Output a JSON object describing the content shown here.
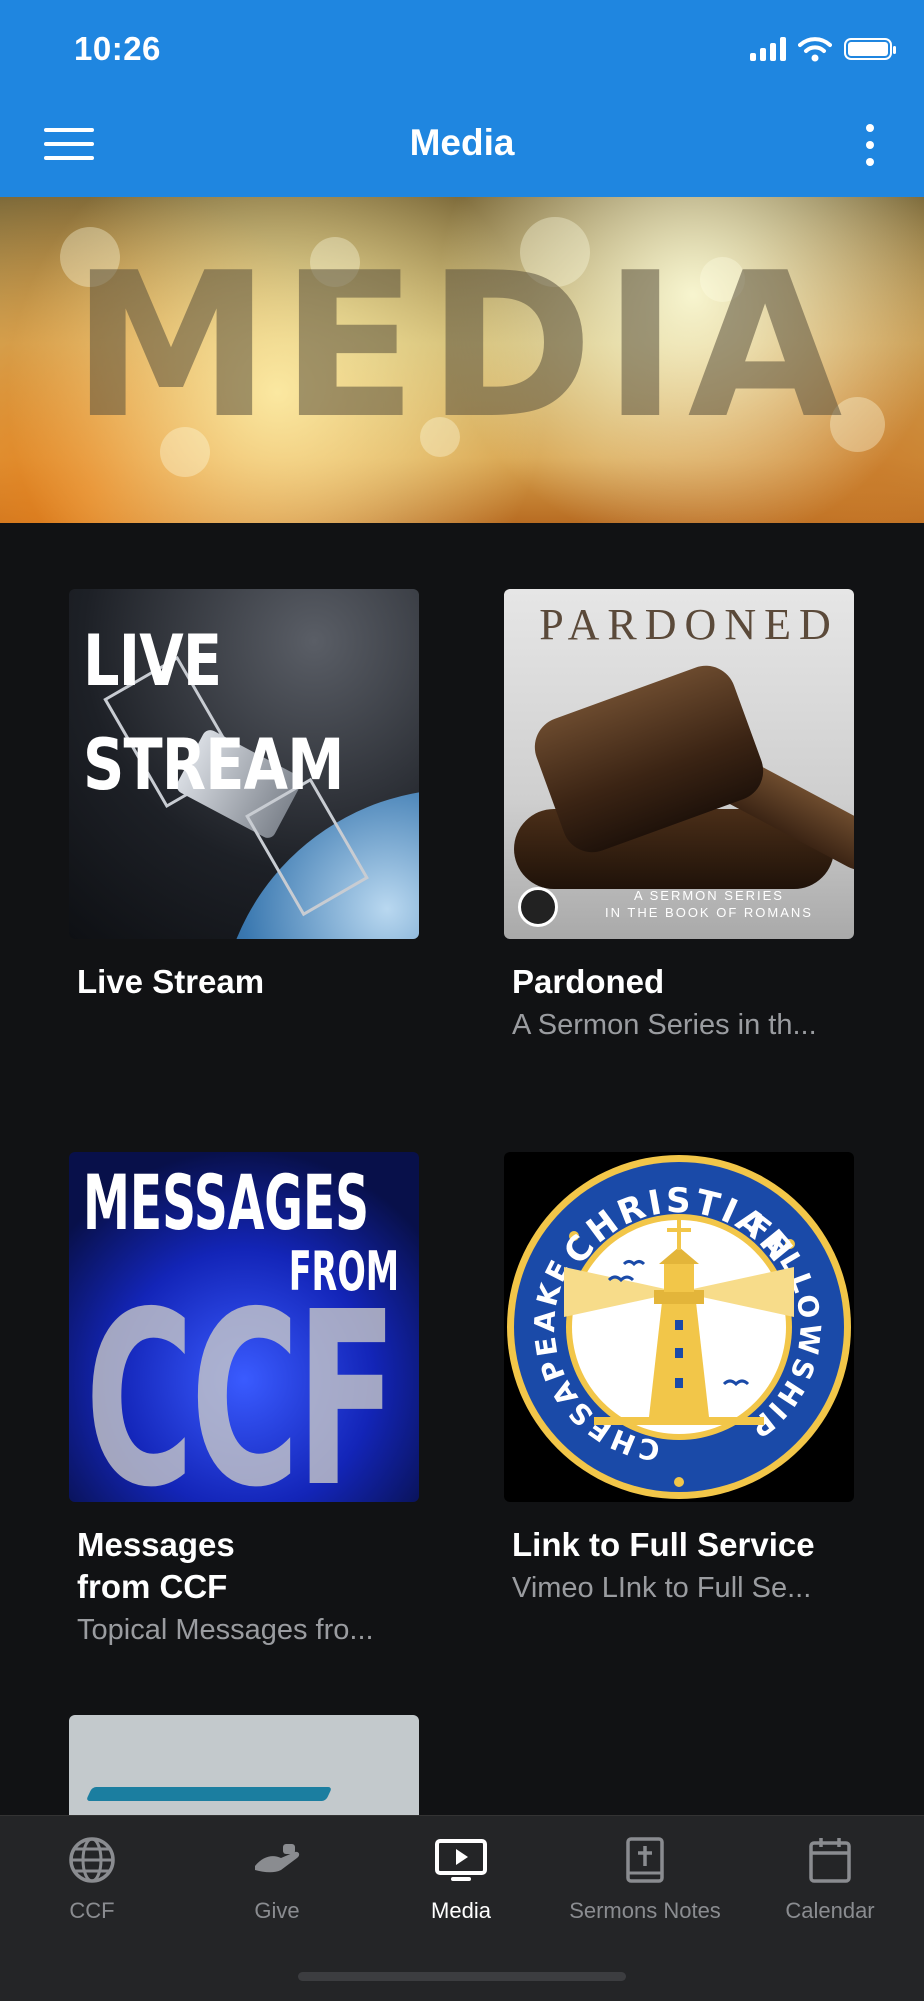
{
  "status_bar": {
    "time": "10:26"
  },
  "header": {
    "title": "Media",
    "menu_icon": "hamburger-icon",
    "more_icon": "more-vertical-icon"
  },
  "banner": {
    "word": "MEDIA"
  },
  "cards": [
    {
      "title": "Live Stream",
      "subtitle": "",
      "thumb_text": [
        "LIVE",
        "STREAM"
      ]
    },
    {
      "title": "Pardoned",
      "subtitle": "A Sermon Series in th...",
      "thumb_heading": "PARDONED",
      "thumb_caption": [
        "A SERMON SERIES",
        "IN THE BOOK OF ROMANS"
      ]
    },
    {
      "title_lines": [
        "Messages",
        "from CCF"
      ],
      "subtitle": "Topical Messages fro...",
      "thumb_text": [
        "MESSAGES",
        "FROM",
        "CCF"
      ]
    },
    {
      "title": "Link to Full Service",
      "subtitle": "Vimeo LInk to Full Se...",
      "logo_text_top": "CHRISTIAN",
      "logo_text_right": "FELLOWSHIP",
      "logo_text_left": "CHESAPEAKE"
    }
  ],
  "tabs": [
    {
      "label": "CCF",
      "icon": "globe-icon"
    },
    {
      "label": "Give",
      "icon": "give-hand-icon"
    },
    {
      "label": "Media",
      "icon": "tv-play-icon",
      "active": true
    },
    {
      "label": "Sermons Notes",
      "icon": "bible-icon"
    },
    {
      "label": "Calendar",
      "icon": "calendar-icon"
    }
  ],
  "colors": {
    "header_blue": "#1f86e0",
    "background": "#111214",
    "tabbar": "#242527",
    "subtitle_gray": "#9a9ca0",
    "logo_blue": "#1a4aa8",
    "logo_gold": "#f2c649"
  }
}
